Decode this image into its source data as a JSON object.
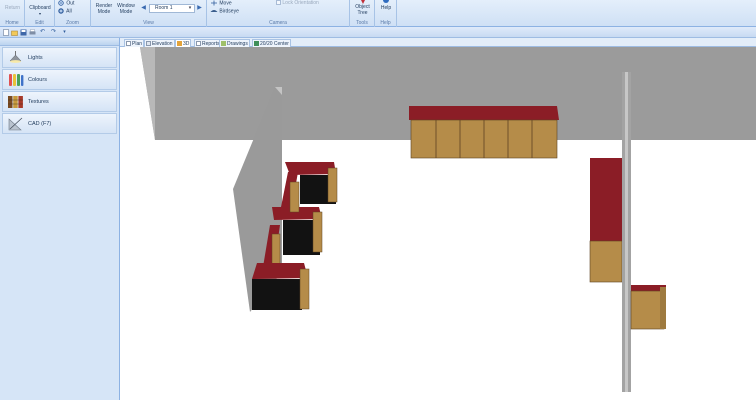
{
  "ribbon": {
    "home": {
      "return_label": "Return",
      "group_label": "Home"
    },
    "edit": {
      "clipboard_label": "Clipboard",
      "group_label": "Edit"
    },
    "zoom": {
      "out_label": "Out",
      "all_label": "All",
      "group_label": "Zoom"
    },
    "view": {
      "render_mode_label": "Render Mode",
      "window_mode_label": "Window Mode",
      "room_value": "Room 1",
      "group_label": "View"
    },
    "camera": {
      "move_label": "Move",
      "birdseye_label": "Birdseye",
      "lock_orientation_label": "Lock Orientation",
      "group_label": "Camera"
    },
    "tools": {
      "object_tree_label": "Object Tree",
      "group_label": "Tools"
    },
    "help": {
      "help_label": "Help",
      "group_label": "Help"
    }
  },
  "left_panel": {
    "items": [
      {
        "label": "Lights",
        "icon": "lamp-icon"
      },
      {
        "label": "Colours",
        "icon": "paint-tubes-icon"
      },
      {
        "label": "Textures",
        "icon": "texture-swatches-icon"
      },
      {
        "label": "CAD (F7)",
        "icon": "cad-set-square-icon"
      }
    ]
  },
  "tabs": [
    {
      "label": "Plan",
      "active": false
    },
    {
      "label": "Elevation",
      "active": false
    },
    {
      "label": "3D",
      "active": true
    },
    {
      "label": "Reports",
      "active": false
    },
    {
      "label": "Drawings",
      "active": false
    },
    {
      "label": "20/20 Center",
      "active": false
    }
  ],
  "colors": {
    "countertop": "#8b1d26",
    "cabinet_wood": "#b58c49",
    "wall_grey": "#9a9a9a",
    "ribbon_blue": "#cfe0f5"
  }
}
